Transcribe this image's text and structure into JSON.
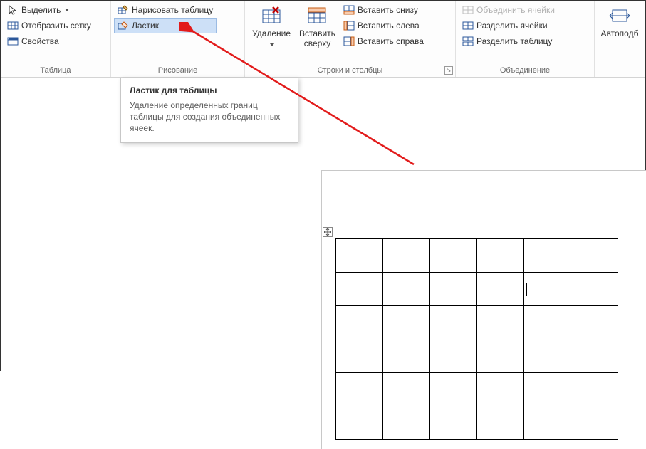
{
  "ribbon": {
    "groups": {
      "table": {
        "label": "Таблица",
        "select": "Выделить",
        "show_grid": "Отобразить сетку",
        "properties": "Свойства"
      },
      "drawing": {
        "label": "Рисование",
        "draw_table": "Нарисовать таблицу",
        "eraser": "Ластик"
      },
      "rows_cols": {
        "label": "Строки и столбцы",
        "delete": "Удаление",
        "insert_above": "Вставить сверху",
        "insert_below": "Вставить снизу",
        "insert_left": "Вставить слева",
        "insert_right": "Вставить справа"
      },
      "merge": {
        "label": "Объединение",
        "merge_cells": "Объединить ячейки",
        "split_cells": "Разделить ячейки",
        "split_table": "Разделить таблицу"
      },
      "autofit": {
        "label_top": "Автоподб"
      }
    }
  },
  "tooltip": {
    "title": "Ластик для таблицы",
    "body": "Удаление определенных границ таблицы для создания объединенных ячеек."
  },
  "doc_table": {
    "rows": 6,
    "cols": 6,
    "cursor_cell": [
      1,
      4
    ]
  }
}
